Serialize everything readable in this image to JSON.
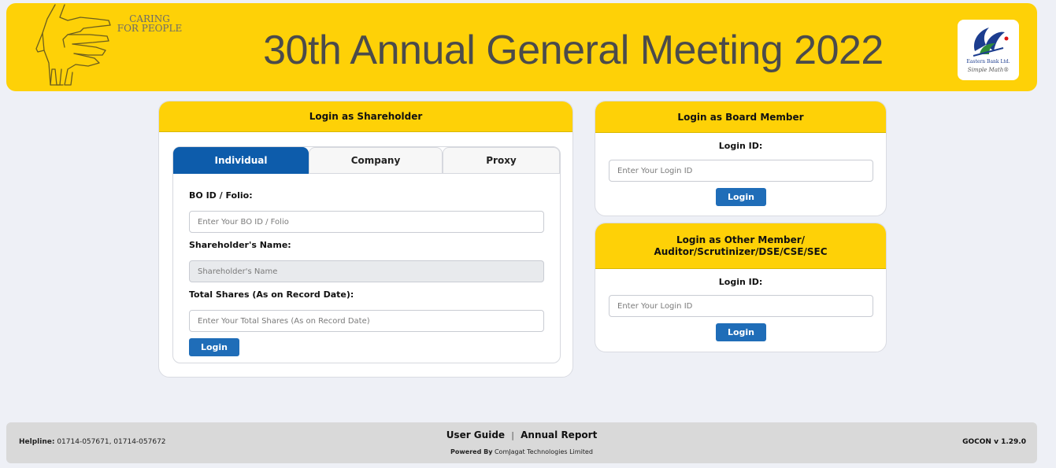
{
  "banner": {
    "slogan_line1": "CARING",
    "slogan_line2": "FOR PEOPLE",
    "title": "30th Annual General Meeting 2022",
    "bank_name": "Eastern Bank Ltd.",
    "bank_tagline": "Simple Math®"
  },
  "shareholder": {
    "heading": "Login as Shareholder",
    "tabs": [
      {
        "label": "Individual",
        "active": true
      },
      {
        "label": "Company",
        "active": false
      },
      {
        "label": "Proxy",
        "active": false
      }
    ],
    "bo_label": "BO ID / Folio:",
    "bo_placeholder": "Enter Your BO ID / Folio",
    "name_label": "Shareholder's Name:",
    "name_placeholder": "Shareholder's Name",
    "shares_label": "Total Shares (As on Record Date):",
    "shares_placeholder": "Enter Your Total Shares (As on Record Date)",
    "login_label": "Login"
  },
  "board": {
    "heading": "Login as Board Member",
    "id_label": "Login ID:",
    "id_placeholder": "Enter Your Login ID",
    "login_label": "Login"
  },
  "other": {
    "heading_line1": "Login as Other Member/",
    "heading_line2": "Auditor/Scrutinizer/DSE/CSE/SEC",
    "id_label": "Login ID:",
    "id_placeholder": "Enter Your Login ID",
    "login_label": "Login"
  },
  "footer": {
    "helpline_label": "Helpline:",
    "helpline_numbers": "01714-057671, 01714-057672",
    "user_guide": "User Guide",
    "separator": "|",
    "annual_report": "Annual Report",
    "powered_by_label": "Powered By",
    "powered_by_company": "ComJagat Technologies Limited",
    "version": "GOCON v 1.29.0"
  },
  "colors": {
    "brand_yellow": "#fed107",
    "primary_blue": "#0d5cab",
    "button_blue": "#1f6db8"
  }
}
